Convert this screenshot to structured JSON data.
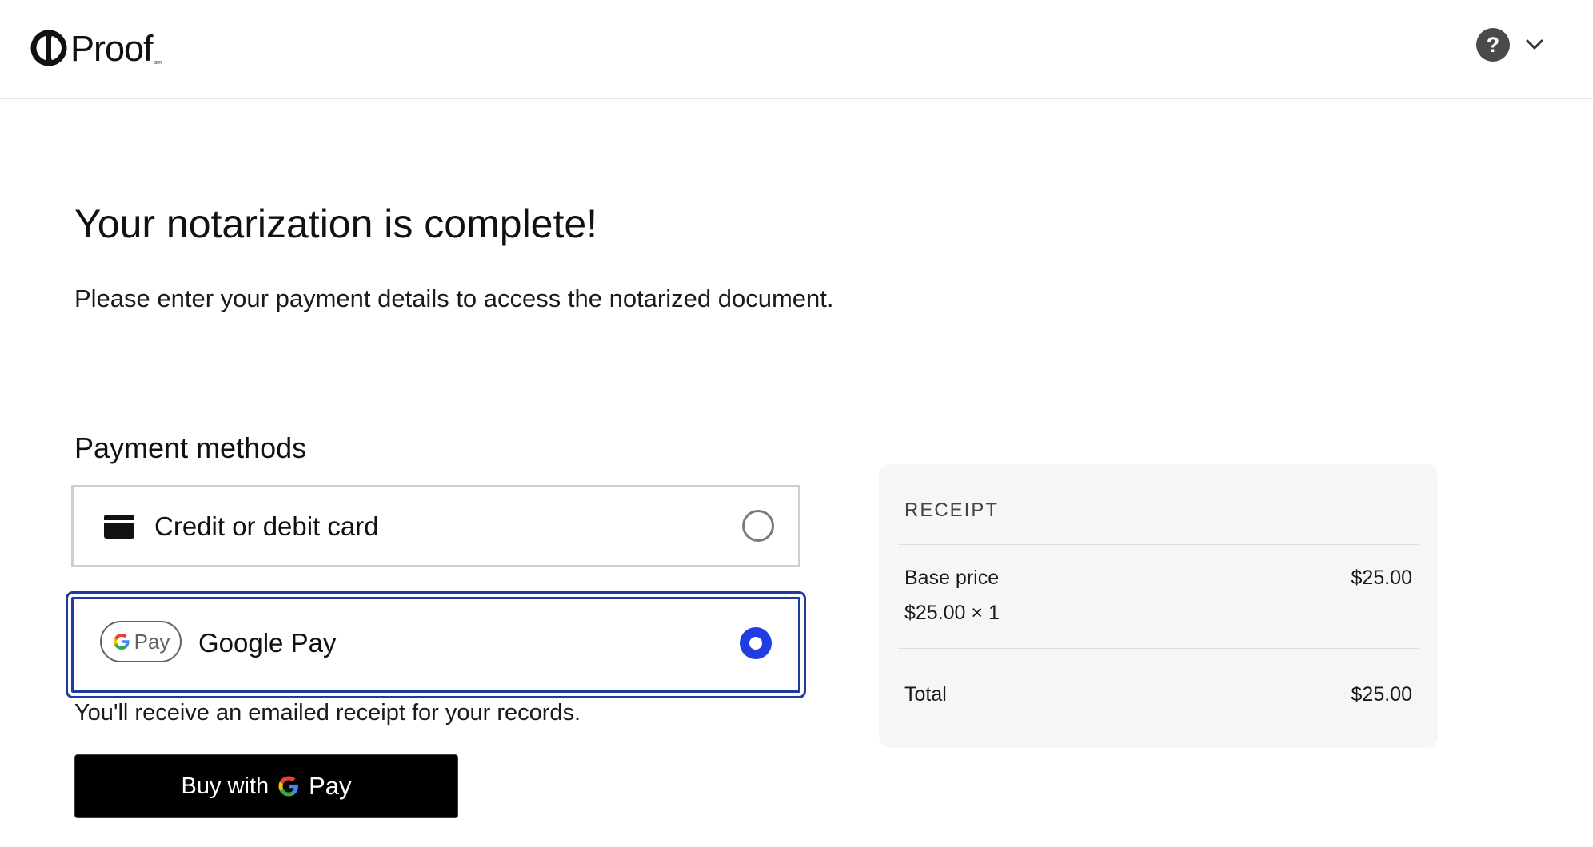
{
  "header": {
    "brand": "Proof",
    "brand_mark": "sm",
    "help_label": "?"
  },
  "main": {
    "title": "Your notarization is complete!",
    "subtitle": "Please enter your payment details to access the notarized document.",
    "payment_methods_heading": "Payment methods",
    "methods": [
      {
        "label": "Credit or debit card",
        "icon": "credit-card-icon",
        "selected": false
      },
      {
        "label": "Google Pay",
        "icon": "google-pay-icon",
        "selected": true,
        "pill_text": "Pay"
      }
    ],
    "receipt_note": "You'll receive an emailed receipt for your records.",
    "buy_button": {
      "prefix": "Buy with",
      "suffix": "Pay"
    }
  },
  "receipt": {
    "title": "RECEIPT",
    "base_price_label": "Base price",
    "base_price_value": "$25.00",
    "base_price_detail": "$25.00 × 1",
    "total_label": "Total",
    "total_value": "$25.00"
  },
  "colors": {
    "accent": "#1f3de0",
    "selected_border": "#1d3a9e",
    "receipt_bg": "#f6f6f4"
  }
}
